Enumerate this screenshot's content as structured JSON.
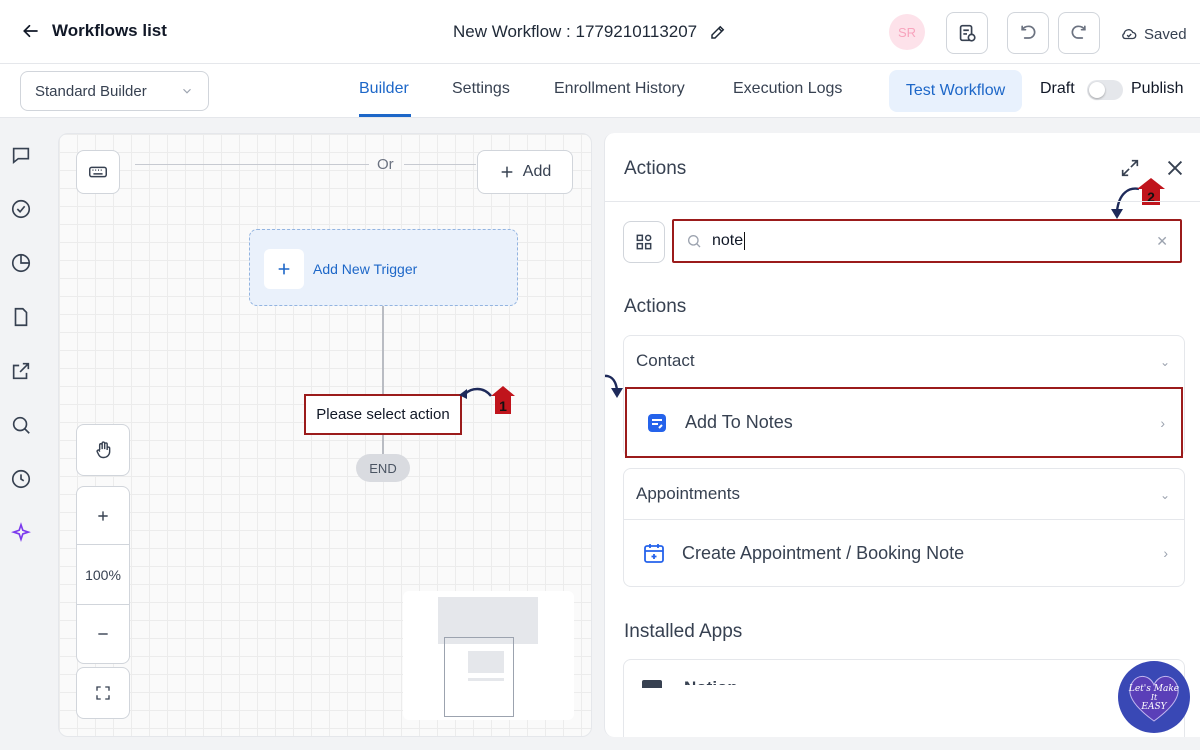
{
  "header": {
    "back_label": "Workflows list",
    "workflow_title": "New Workflow : 1779210113207",
    "avatar_initials": "SR",
    "saved_label": "Saved"
  },
  "subbar": {
    "builder_select": "Standard Builder",
    "tabs": [
      {
        "label": "Builder",
        "active": true
      },
      {
        "label": "Settings",
        "active": false
      },
      {
        "label": "Enrollment History",
        "active": false
      },
      {
        "label": "Execution Logs",
        "active": false
      }
    ],
    "test_button": "Test Workflow",
    "draft_label": "Draft",
    "publish_label": "Publish",
    "publish_enabled": false
  },
  "rail_icons": [
    "chat-icon",
    "check-circle-icon",
    "pie-chart-icon",
    "document-icon",
    "external-link-icon",
    "search-icon",
    "history-icon",
    "sparkle-icon"
  ],
  "canvas": {
    "or_label": "Or",
    "add_label": "Add",
    "trigger_label": "Add New Trigger",
    "select_action_label": "Please select action",
    "end_label": "END",
    "zoom_level": "100%"
  },
  "panel": {
    "title": "Actions",
    "search_value": "note",
    "section_actions": "Actions",
    "groups": [
      {
        "title": "Contact",
        "items": [
          {
            "label": "Add To Notes"
          }
        ]
      },
      {
        "title": "Appointments",
        "items": [
          {
            "label": "Create Appointment / Booking Note"
          }
        ]
      }
    ],
    "section_installed": "Installed Apps",
    "installed_partial": "Notion"
  },
  "annotations": {
    "markers": [
      "1",
      "2",
      "3"
    ],
    "accent_color": "#9b1b1b"
  },
  "brand_badge": "Let's Make It EASY",
  "colors": {
    "primary": "#1d67c8",
    "highlight": "#9b1b1b"
  }
}
